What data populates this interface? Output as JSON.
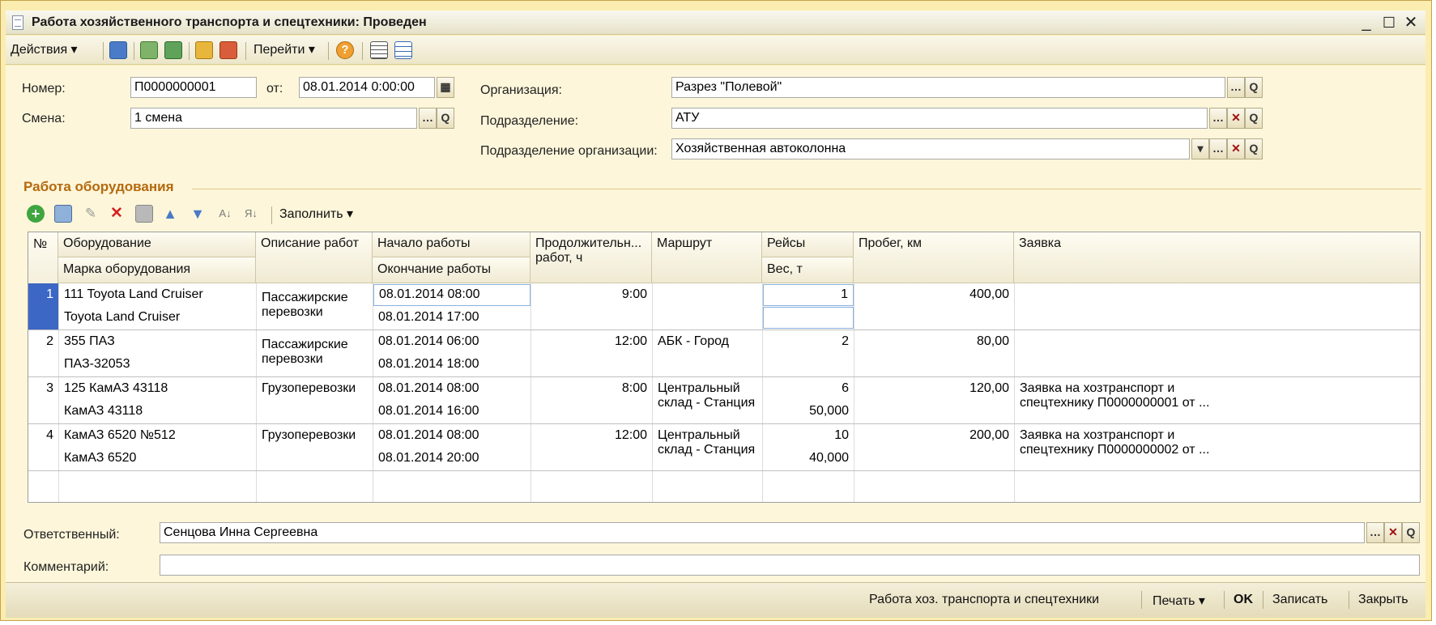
{
  "window": {
    "title": "Работа хозяйственного транспорта и спецтехники: Проведен"
  },
  "toolbar": {
    "actions": "Действия",
    "goto": "Перейти"
  },
  "header": {
    "number_label": "Номер:",
    "number": "П0000000001",
    "from_label": "от:",
    "date": "08.01.2014  0:00:00",
    "shift_label": "Смена:",
    "shift": "1 смена",
    "org_label": "Организация:",
    "org": "Разрез \"Полевой\"",
    "dept_label": "Подразделение:",
    "dept": "АТУ",
    "orgdept_label": "Подразделение организации:",
    "orgdept": "Хозяйственная автоколонна"
  },
  "section": {
    "title": "Работа оборудования",
    "fill": "Заполнить"
  },
  "grid": {
    "headers": {
      "num": "№",
      "equipment": "Оборудование",
      "brand": "Марка оборудования",
      "desc": "Описание работ",
      "start": "Начало работы",
      "end": "Окончание работы",
      "duration_1": "Продолжительн...",
      "duration_2": "работ, ч",
      "route": "Маршрут",
      "trips": "Рейсы",
      "weight": "Вес, т",
      "mileage": "Пробег, км",
      "order": "Заявка"
    },
    "rows": [
      {
        "num": "1",
        "equipment": "111 Toyota Land Cruiser",
        "brand": "Toyota Land Cruiser",
        "desc_1": "Пассажирские",
        "desc_2": "перевозки",
        "start": "08.01.2014 08:00",
        "end": "08.01.2014 17:00",
        "duration": "9:00",
        "route_1": "",
        "route_2": "",
        "trips": "1",
        "weight": "",
        "mileage": "400,00",
        "order_1": "",
        "order_2": ""
      },
      {
        "num": "2",
        "equipment": "355 ПАЗ",
        "brand": "ПАЗ-32053",
        "desc_1": "Пассажирские",
        "desc_2": "перевозки",
        "start": "08.01.2014 06:00",
        "end": "08.01.2014 18:00",
        "duration": "12:00",
        "route_1": "АБК - Город",
        "route_2": "",
        "trips": "2",
        "weight": "",
        "mileage": "80,00",
        "order_1": "",
        "order_2": ""
      },
      {
        "num": "3",
        "equipment": "125 КамАЗ 43118",
        "brand": "КамАЗ 43118",
        "desc_1": "Грузоперевозки",
        "desc_2": "",
        "start": "08.01.2014 08:00",
        "end": "08.01.2014 16:00",
        "duration": "8:00",
        "route_1": "Центральный",
        "route_2": "склад - Станция",
        "trips": "6",
        "weight": "50,000",
        "mileage": "120,00",
        "order_1": "Заявка на хозтранспорт и",
        "order_2": "спецтехнику П0000000001 от ..."
      },
      {
        "num": "4",
        "equipment": "КамАЗ 6520 №512",
        "brand": "КамАЗ 6520",
        "desc_1": "Грузоперевозки",
        "desc_2": "",
        "start": "08.01.2014 08:00",
        "end": "08.01.2014 20:00",
        "duration": "12:00",
        "route_1": "Центральный",
        "route_2": "склад - Станция",
        "trips": "10",
        "weight": "40,000",
        "mileage": "200,00",
        "order_1": "Заявка на хозтранспорт и",
        "order_2": "спецтехнику П0000000002 от ..."
      }
    ]
  },
  "footer": {
    "responsible_label": "Ответственный:",
    "responsible": "Сенцова Инна Сергеевна",
    "comment_label": "Комментарий:",
    "comment": ""
  },
  "bottom": {
    "report": "Работа хоз. транспорта и спецтехники",
    "print": "Печать",
    "ok": "OK",
    "save": "Записать",
    "close": "Закрыть"
  }
}
